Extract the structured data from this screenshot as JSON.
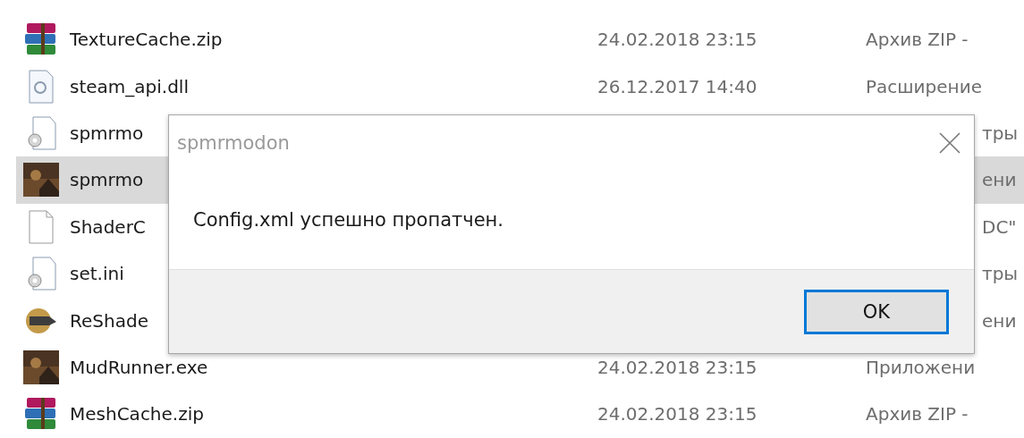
{
  "files": [
    {
      "kind": "zip",
      "name": "TextureCache.zip",
      "date": "24.02.2018 23:15",
      "type": "Архив ZIP -",
      "selected": false
    },
    {
      "kind": "dll",
      "name": "steam_api.dll",
      "date": "26.12.2017 14:40",
      "type": "Расширение",
      "selected": false
    },
    {
      "kind": "config",
      "name": "spmrmo",
      "type_fragment": "тры",
      "selected": false
    },
    {
      "name": "spmrmo",
      "type_fragment": "ени",
      "selected": true
    },
    {
      "kind": "blank",
      "name": "ShaderC",
      "type_fragment": "DC\"",
      "selected": false
    },
    {
      "kind": "config",
      "name": "set.ini",
      "type_fragment": "тры",
      "selected": false
    },
    {
      "kind": "reshade",
      "name": "ReShade",
      "type_fragment": "ени",
      "selected": false
    },
    {
      "name": "MudRunner.exe",
      "date": "24.02.2018 23:15",
      "type": "Приложени",
      "selected": false
    },
    {
      "kind": "zip",
      "name": "MeshCache.zip",
      "date": "24.02.2018 23:15",
      "type": "Архив ZIP -",
      "selected": false
    }
  ],
  "dialog": {
    "title": "spmrmodon",
    "message": "Config.xml успешно пропатчен.",
    "button": "OK"
  }
}
